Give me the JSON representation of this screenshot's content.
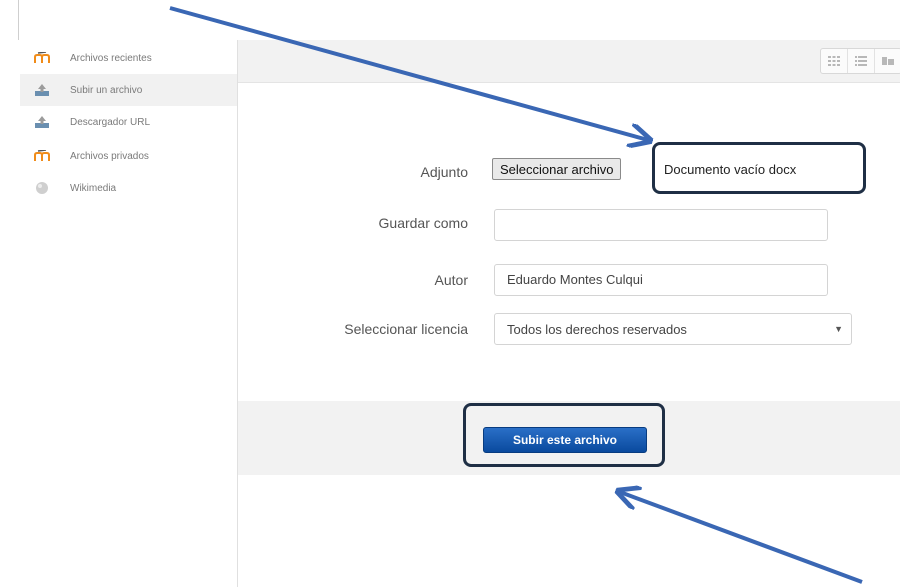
{
  "sidebar": {
    "items": [
      {
        "label": "Archivos recientes",
        "icon": "moodle-icon",
        "active": false
      },
      {
        "label": "Subir un archivo",
        "icon": "upload-icon",
        "active": true
      },
      {
        "label": "Descargador URL",
        "icon": "upload-icon",
        "active": false
      },
      {
        "label": "Archivos privados",
        "icon": "moodle-icon",
        "active": false
      },
      {
        "label": "Wikimedia",
        "icon": "wikimedia-icon",
        "active": false
      }
    ]
  },
  "toolbar": {
    "view_buttons": [
      "grid-view-icon",
      "list-view-icon",
      "tree-view-icon"
    ]
  },
  "form": {
    "attachment_label": "Adjunto",
    "choose_file_label": "Seleccionar archivo",
    "file_name": "Documento vacío docx",
    "save_as_label": "Guardar como",
    "save_as_value": "",
    "author_label": "Autor",
    "author_value": "Eduardo Montes Culqui",
    "license_label": "Seleccionar licencia",
    "license_value": "Todos los derechos reservados",
    "submit_label": "Subir este archivo"
  },
  "colors": {
    "accent_blue": "#0a4a9e",
    "annotation_arrow": "#3a67b4",
    "annotation_box": "#1f2f45"
  }
}
